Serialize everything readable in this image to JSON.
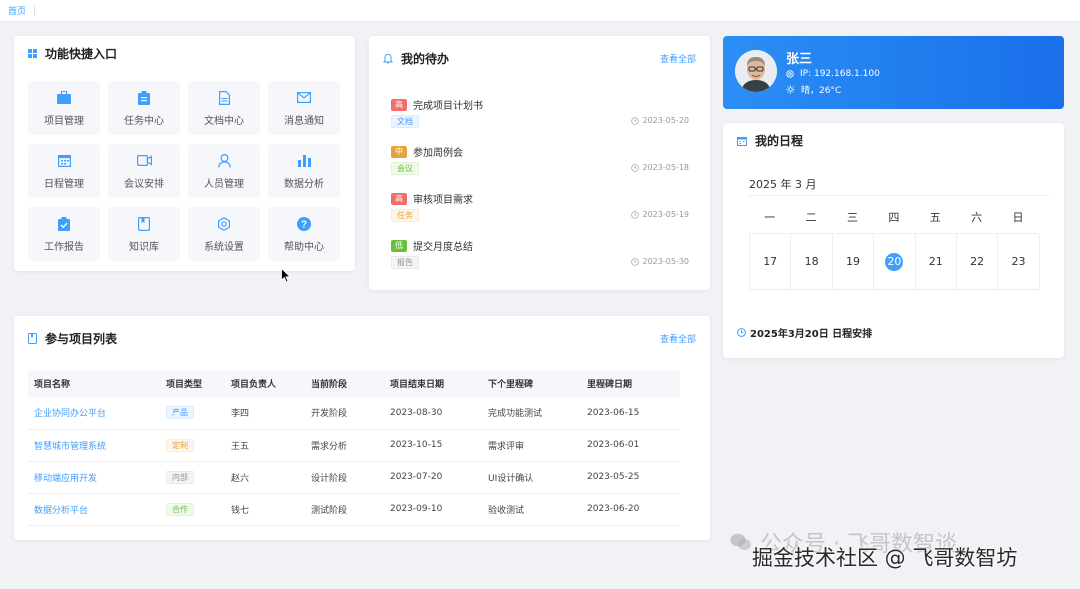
{
  "breadcrumb": {
    "home": "首页"
  },
  "quick_access": {
    "title": "功能快捷入口",
    "items": [
      {
        "label": "项目管理",
        "icon": "briefcase-icon"
      },
      {
        "label": "任务中心",
        "icon": "clipboard-icon"
      },
      {
        "label": "文档中心",
        "icon": "document-icon"
      },
      {
        "label": "消息通知",
        "icon": "envelope-icon"
      },
      {
        "label": "日程管理",
        "icon": "calendar-icon"
      },
      {
        "label": "会议安排",
        "icon": "video-icon"
      },
      {
        "label": "人员管理",
        "icon": "user-icon"
      },
      {
        "label": "数据分析",
        "icon": "bar-chart-icon"
      },
      {
        "label": "工作报告",
        "icon": "clipboard-check-icon"
      },
      {
        "label": "知识库",
        "icon": "book-icon"
      },
      {
        "label": "系统设置",
        "icon": "gear-icon"
      },
      {
        "label": "帮助中心",
        "icon": "help-icon"
      }
    ]
  },
  "todos": {
    "title": "我的待办",
    "view_all": "查看全部",
    "items": [
      {
        "priority": "高",
        "priority_color": "#f56c6c",
        "title": "完成项目计划书",
        "tag": "文档",
        "tag_color": "#409eff",
        "tag_bg": "#ecf5ff",
        "date": "2023-05-20"
      },
      {
        "priority": "中",
        "priority_color": "#e6a23c",
        "title": "参加周例会",
        "tag": "会议",
        "tag_color": "#67c23a",
        "tag_bg": "#f0f9eb",
        "date": "2023-05-18"
      },
      {
        "priority": "高",
        "priority_color": "#f56c6c",
        "title": "审核项目需求",
        "tag": "任务",
        "tag_color": "#e6a23c",
        "tag_bg": "#fdf6ec",
        "date": "2023-05-19"
      },
      {
        "priority": "低",
        "priority_color": "#67c23a",
        "title": "提交月度总结",
        "tag": "报告",
        "tag_color": "#909399",
        "tag_bg": "#f4f4f5",
        "date": "2023-05-30"
      }
    ]
  },
  "user": {
    "name": "张三",
    "ip": "IP: 192.168.1.100",
    "weather": "晴，26°C"
  },
  "schedule": {
    "title": "我的日程",
    "month": "2025 年 3 月",
    "weekdays": [
      "一",
      "二",
      "三",
      "四",
      "五",
      "六",
      "日"
    ],
    "days": [
      "17",
      "18",
      "19",
      "20",
      "21",
      "22",
      "23"
    ],
    "selected_day": "20",
    "agenda_title": "2025年3月20日 日程安排"
  },
  "projects": {
    "title": "参与项目列表",
    "view_all": "查看全部",
    "columns": [
      "项目名称",
      "项目类型",
      "项目负责人",
      "当前阶段",
      "项目结束日期",
      "下个里程碑",
      "里程碑日期"
    ],
    "rows": [
      {
        "name": "企业协同办公平台",
        "type": "产品",
        "type_color": "#409eff",
        "type_bg": "#ecf5ff",
        "owner": "李四",
        "stage": "开发阶段",
        "end": "2023-08-30",
        "milestone": "完成功能测试",
        "milestone_date": "2023-06-15"
      },
      {
        "name": "智慧城市管理系统",
        "type": "定制",
        "type_color": "#e6a23c",
        "type_bg": "#fdf6ec",
        "owner": "王五",
        "stage": "需求分析",
        "end": "2023-10-15",
        "milestone": "需求评审",
        "milestone_date": "2023-06-01"
      },
      {
        "name": "移动端应用开发",
        "type": "内部",
        "type_color": "#909399",
        "type_bg": "#f4f4f5",
        "owner": "赵六",
        "stage": "设计阶段",
        "end": "2023-07-20",
        "milestone": "UI设计确认",
        "milestone_date": "2023-05-25"
      },
      {
        "name": "数据分析平台",
        "type": "合作",
        "type_color": "#67c23a",
        "type_bg": "#f0f9eb",
        "owner": "钱七",
        "stage": "测试阶段",
        "end": "2023-09-10",
        "milestone": "验收测试",
        "milestone_date": "2023-06-20"
      }
    ]
  },
  "watermark": {
    "line1": "公众号 · 飞哥数智谈",
    "line2": "掘金技术社区 @ 飞哥数智坊"
  }
}
